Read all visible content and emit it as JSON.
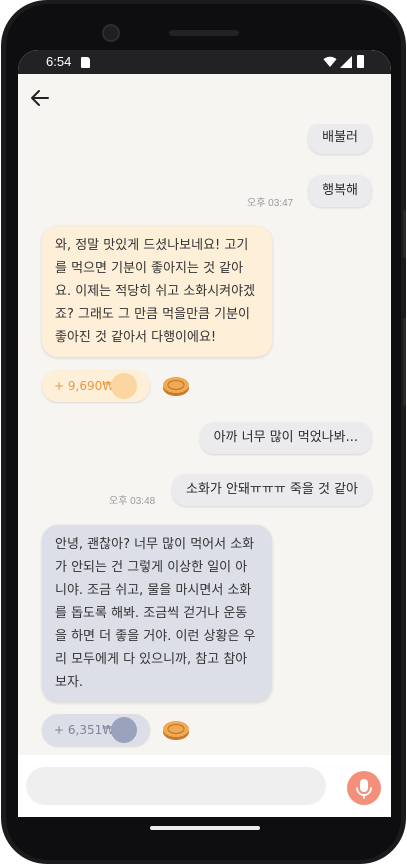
{
  "status_bar": {
    "time": "6:54"
  },
  "colors": {
    "accent_mic": "#f4907a",
    "reward_warm_text": "#e79a43",
    "reward_cool_text": "#7e869c"
  },
  "icons": {
    "back": "arrow-left-icon",
    "mic": "microphone-icon",
    "coin": "coin-icon",
    "sd_card": "sd-card-icon",
    "wifi": "wifi-icon",
    "signal": "signal-icon",
    "battery": "battery-icon"
  },
  "messages": {
    "user_1": "배불러",
    "user_2": "행복해",
    "time_1": "오후 03:47",
    "ai_1": "와, 정말 맛있게 드셨나보네요! 고기를 먹으면 기분이 좋아지는 것 같아요. 이제는 적당히 쉬고 소화시켜야겠죠? 그래도 그 만큼 먹을만큼 기분이 좋아진 것 같아서 다행이에요!",
    "reward_1": "+ 9,690₩",
    "user_3": "아까 너무 많이 먹었나봐...",
    "user_4": "소화가 안돼ㅠㅠㅠ 죽을 것 같아",
    "time_2": "오후 03:48",
    "ai_2": "안녕, 괜찮아? 너무 많이 먹어서 소화가 안되는 건 그렇게 이상한 일이 아니야. 조금 쉬고, 물을 마시면서 소화를 돕도록 해봐. 조금씩 걷거나 운동을 하면 더 좋을 거야. 이런 상황은 우리 모두에게 다 있으니까, 참고 참아보자.",
    "reward_2": "+ 6,351₩"
  },
  "input": {
    "value": "",
    "placeholder": ""
  }
}
